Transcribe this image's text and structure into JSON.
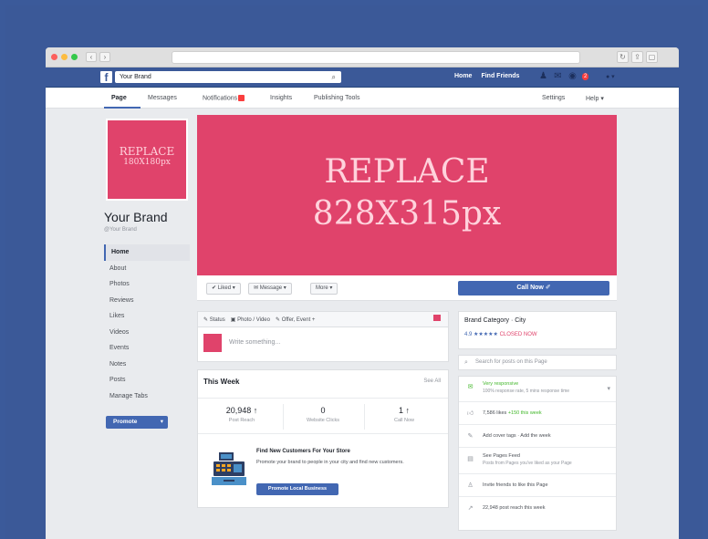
{
  "browser": {
    "url": "",
    "back": "‹",
    "forward": "›"
  },
  "fb": {
    "logo": "f",
    "search_value": "Your Brand",
    "nav": [
      "Home",
      "Find Friends"
    ],
    "badge": "2"
  },
  "tabs": {
    "items": [
      {
        "label": "Page"
      },
      {
        "label": "Messages"
      },
      {
        "label": "Notifications"
      },
      {
        "label": "Insights"
      },
      {
        "label": "Publishing Tools"
      }
    ],
    "settings": "Settings",
    "help": "Help ▾"
  },
  "profile": {
    "line1": "REPLACE",
    "line2": "180X180px"
  },
  "page": {
    "name": "Your Brand",
    "handle": "@Your Brand"
  },
  "leftnav": [
    "Home",
    "About",
    "Photos",
    "Reviews",
    "Likes",
    "Videos",
    "Events",
    "Notes",
    "Posts",
    "Manage Tabs"
  ],
  "promote": "Promote",
  "cover": {
    "line1": "REPLACE",
    "line2": "828X315px"
  },
  "actions": {
    "liked": "Liked ▾",
    "message": "Message ▾",
    "more": "More ▾",
    "call": "Call Now ✐"
  },
  "composer": {
    "tabs": [
      "Status",
      "Photo / Video",
      "Offer, Event +"
    ],
    "placeholder": "Write something..."
  },
  "thisweek": {
    "title": "This Week",
    "see_all": "See All",
    "stats": [
      {
        "num": "20,948 ↑",
        "label": "Post Reach"
      },
      {
        "num": "0",
        "label": "Website Clicks"
      },
      {
        "num": "1 ↑",
        "label": "Call Now"
      }
    ],
    "headline": "Find New Customers For Your Store",
    "body": "Promote your brand to people in your city and find new customers.",
    "button": "Promote Local Business"
  },
  "about": {
    "title": "Brand Category · City",
    "rating": "4.9 ★★★★★",
    "closed": "CLOSED NOW"
  },
  "search_posts": "Search for posts on this Page",
  "info": {
    "row1_title": "Very responsive",
    "row1_sub": "100% response rate, 5 mins response time",
    "row2_green": "7,586 likes",
    "row2_rest": " +150 this week",
    "row3": "Add cover tags  ·  Add the week",
    "row4_title": "See Pages Feed",
    "row4_sub": "Posts from Pages you've liked as your Page",
    "row5": "Invite friends to like this Page",
    "row6": "22,948 post reach this week"
  }
}
